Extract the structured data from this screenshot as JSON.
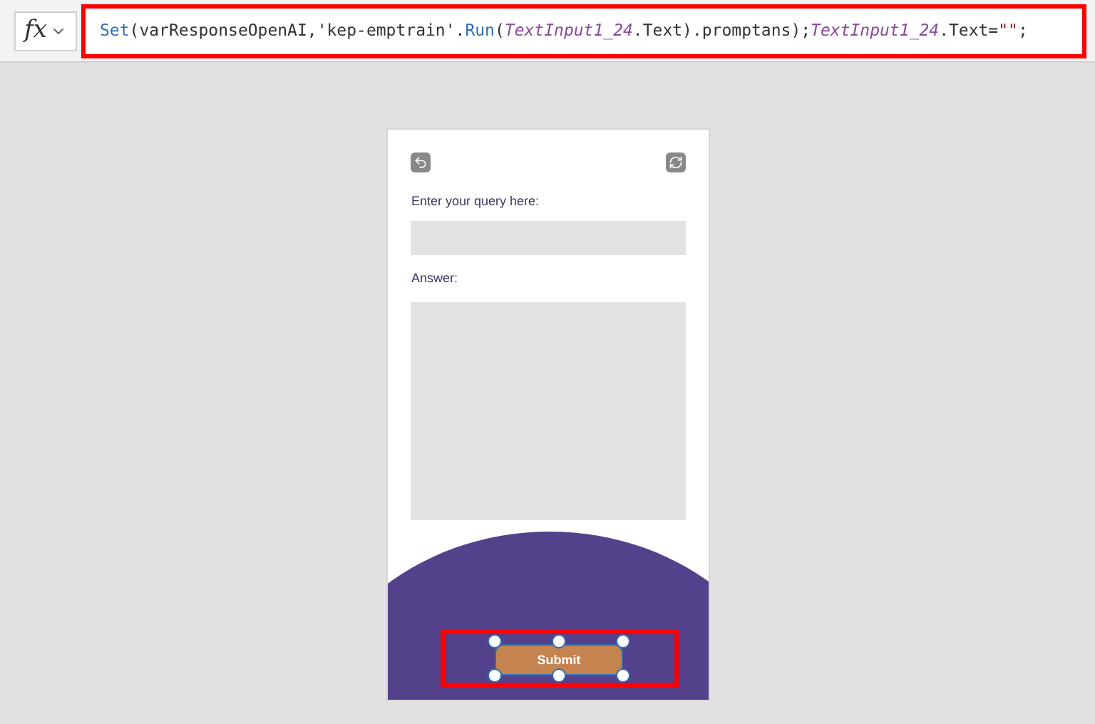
{
  "formula_bar": {
    "fx_label": "fx",
    "formula": [
      {
        "text": "Set",
        "kind": "function"
      },
      {
        "text": "(varResponseOpenAI,'kep-emptrain'.",
        "kind": "plain"
      },
      {
        "text": "Run",
        "kind": "function"
      },
      {
        "text": "(",
        "kind": "plain"
      },
      {
        "text": "TextInput1_24",
        "kind": "control"
      },
      {
        "text": ".Text).promptans);",
        "kind": "plain"
      },
      {
        "text": "TextInput1_24",
        "kind": "control"
      },
      {
        "text": ".Text=",
        "kind": "plain"
      },
      {
        "text": "\"\"",
        "kind": "string"
      },
      {
        "text": ";",
        "kind": "plain"
      }
    ]
  },
  "app": {
    "query_label": "Enter your query here:",
    "answer_label": "Answer:",
    "submit": {
      "label": "Submit",
      "selected": true
    }
  }
}
